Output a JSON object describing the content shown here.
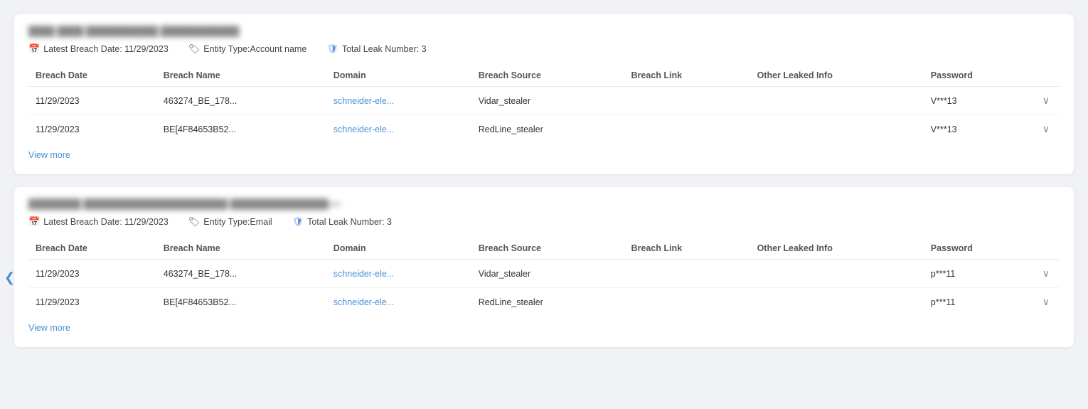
{
  "sections": [
    {
      "id": "section1",
      "title": "████ ████ ███████████ ████████████",
      "meta": {
        "latest_breach_date_label": "Latest Breach Date:",
        "latest_breach_date_value": "11/29/2023",
        "entity_type_label": "Entity Type:",
        "entity_type_value": "Account name",
        "total_leak_label": "Total Leak Number:",
        "total_leak_value": "3"
      },
      "columns": [
        "Breach Date",
        "Breach Name",
        "Domain",
        "Breach Source",
        "Breach Link",
        "Other Leaked Info",
        "Password"
      ],
      "rows": [
        {
          "breach_date": "11/29/2023",
          "breach_name": "463274_BE_178...",
          "domain": "schneider-ele...",
          "breach_source": "Vidar_stealer",
          "breach_link": "",
          "other_leaked_info": "",
          "password": "V***13"
        },
        {
          "breach_date": "11/29/2023",
          "breach_name": "BE[4F84653B52...",
          "domain": "schneider-ele...",
          "breach_source": "RedLine_stealer",
          "breach_link": "",
          "other_leaked_info": "",
          "password": "V***13"
        }
      ],
      "view_more_label": "View more"
    },
    {
      "id": "section2",
      "title": "████████ ██████████████████████ ███████████████om",
      "meta": {
        "latest_breach_date_label": "Latest Breach Date:",
        "latest_breach_date_value": "11/29/2023",
        "entity_type_label": "Entity Type:",
        "entity_type_value": "Email",
        "total_leak_label": "Total Leak Number:",
        "total_leak_value": "3"
      },
      "columns": [
        "Breach Date",
        "Breach Name",
        "Domain",
        "Breach Source",
        "Breach Link",
        "Other Leaked Info",
        "Password"
      ],
      "rows": [
        {
          "breach_date": "11/29/2023",
          "breach_name": "463274_BE_178...",
          "domain": "schneider-ele...",
          "breach_source": "Vidar_stealer",
          "breach_link": "",
          "other_leaked_info": "",
          "password": "p***11"
        },
        {
          "breach_date": "11/29/2023",
          "breach_name": "BE[4F84653B52...",
          "domain": "schneider-ele...",
          "breach_source": "RedLine_stealer",
          "breach_link": "",
          "other_leaked_info": "",
          "password": "p***11"
        }
      ],
      "view_more_label": "View more"
    }
  ],
  "back_arrow": "❮",
  "expand_icon": "∨",
  "cursor_symbol": "↖"
}
